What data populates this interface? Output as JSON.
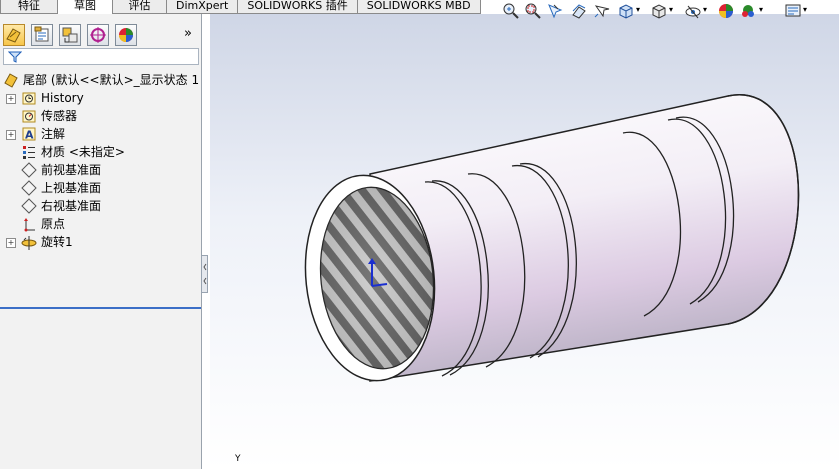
{
  "tabs": [
    {
      "label": "特征",
      "active": false
    },
    {
      "label": "草图",
      "active": true
    },
    {
      "label": "评估",
      "active": false
    },
    {
      "label": "DimXpert",
      "active": false
    },
    {
      "label": "SOLIDWORKS 插件",
      "active": false
    },
    {
      "label": "SOLIDWORKS MBD",
      "active": false
    }
  ],
  "panel": {
    "toolbar_icons": [
      "feature-manager-icon",
      "property-manager-icon",
      "configuration-manager-icon",
      "dimxpert-manager-icon",
      "display-manager-icon"
    ],
    "expand_label": "»"
  },
  "tree": {
    "root": "尾部 (默认<<默认>_显示状态 1",
    "items": [
      {
        "label": "History",
        "icon": "history-icon",
        "expandable": true
      },
      {
        "label": "传感器",
        "icon": "sensor-icon",
        "expandable": false
      },
      {
        "label": "注解",
        "icon": "annotation-icon",
        "expandable": true
      },
      {
        "label": "材质 <未指定>",
        "icon": "material-icon",
        "expandable": false
      },
      {
        "label": "前视基准面",
        "icon": "plane-icon",
        "expandable": false
      },
      {
        "label": "上视基准面",
        "icon": "plane-icon",
        "expandable": false
      },
      {
        "label": "右视基准面",
        "icon": "plane-icon",
        "expandable": false
      },
      {
        "label": "原点",
        "icon": "origin-icon",
        "expandable": false
      },
      {
        "label": "旋转1",
        "icon": "revolve-icon",
        "expandable": true
      }
    ]
  },
  "triad_label": "Y",
  "colors": {
    "accent_blue": "#3c6fc7",
    "part_body": "#ece4f0",
    "viewport_top": "#cfd6e6"
  }
}
